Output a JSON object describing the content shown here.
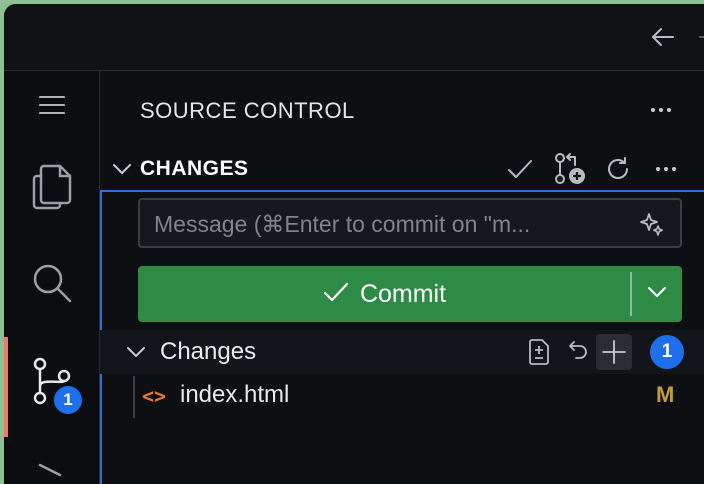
{
  "sidebar": {
    "title": "SOURCE CONTROL",
    "section_title": "CHANGES",
    "source_control_badge": "1"
  },
  "commit": {
    "message_placeholder": "Message (⌘Enter to commit on \"m...",
    "button_label": "Commit"
  },
  "changes_group": {
    "label": "Changes",
    "count": "1"
  },
  "files": [
    {
      "name": "index.html",
      "status": "M"
    }
  ],
  "colors": {
    "commit_green": "#2e8b45",
    "badge_blue": "#1f6feb",
    "focus_blue": "#2f6fd6",
    "active_accent": "#f27a63",
    "modified_status": "#c39b3c",
    "html_icon": "#e37933"
  },
  "icons": {
    "menu": "hamburger-icon",
    "explorer": "files-icon",
    "search": "search-icon",
    "source_control": "source-control-icon",
    "run": "run-debug-icon",
    "back": "arrow-left-icon"
  }
}
